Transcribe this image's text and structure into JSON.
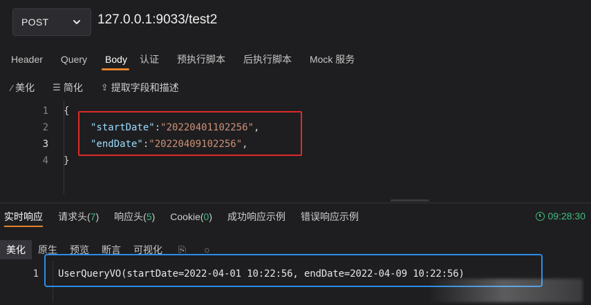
{
  "request": {
    "method": "POST",
    "url": "127.0.0.1:9033/test2"
  },
  "request_tabs": [
    {
      "label": "Header"
    },
    {
      "label": "Query"
    },
    {
      "label": "Body",
      "active": true
    },
    {
      "label": "认证"
    },
    {
      "label": "预执行脚本"
    },
    {
      "label": "后执行脚本"
    },
    {
      "label": "Mock 服务"
    }
  ],
  "body_toolbar": {
    "beautify": "美化",
    "simplify": "简化",
    "extract": "提取字段和描述"
  },
  "body_editor": {
    "line_numbers": [
      "1",
      "2",
      "3",
      "4"
    ],
    "open_brace": "{",
    "close_brace": "}",
    "fields": [
      {
        "key": "\"startDate\"",
        "value": "\"20220401102256\""
      },
      {
        "key": "\"endDate\"",
        "value": "\"20220409102256\""
      }
    ],
    "colon": ":",
    "comma": ","
  },
  "response_tabs": [
    {
      "label": "实时响应",
      "count": "",
      "active": true
    },
    {
      "label": "请求头",
      "count": "7"
    },
    {
      "label": "响应头",
      "count": "5"
    },
    {
      "label": "Cookie",
      "count": "0"
    },
    {
      "label": "成功响应示例",
      "count": ""
    },
    {
      "label": "错误响应示例",
      "count": ""
    }
  ],
  "response_time": "09:28:30",
  "response_view": {
    "beautify": "美化",
    "raw": "原生",
    "preview": "预览",
    "assert": "断言",
    "visualize": "可视化"
  },
  "response_body": {
    "line_number": "1",
    "text": "UserQueryVO(startDate=2022-04-01 10:22:56, endDate=2022-04-09 10:22:56)"
  },
  "colors": {
    "accent": "#e8842e",
    "highlight_red": "#e02a2a",
    "highlight_blue": "#2b8fe8",
    "success_green": "#3fbf7f"
  },
  "icons": {
    "method_dropdown": "chevron-down-icon",
    "beautify": "magic-wand-icon",
    "simplify": "list-icon",
    "extract": "upload-icon",
    "time": "clock-icon",
    "copy": "copy-icon",
    "search": "search-icon"
  }
}
